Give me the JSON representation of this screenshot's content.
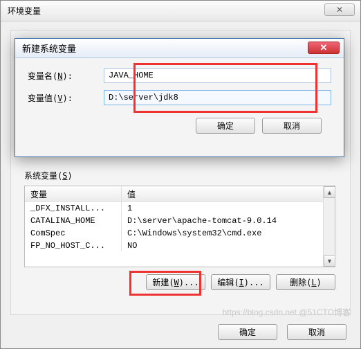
{
  "outer": {
    "title": "环境变量",
    "ok": "确定",
    "cancel": "取消"
  },
  "inner": {
    "title": "新建系统变量",
    "name_label_pre": "变量名(",
    "name_label_u": "N",
    "name_label_post": "):",
    "value_label_pre": "变量值(",
    "value_label_u": "V",
    "value_label_post": "):",
    "name_value": "JAVA_HOME",
    "value_value": "D:\\server\\jdk8",
    "ok": "确定",
    "cancel": "取消"
  },
  "sysvar": {
    "group_label_pre": "系统变量(",
    "group_label_u": "S",
    "group_label_post": ")",
    "col_var": "变量",
    "col_val": "值",
    "rows": [
      {
        "name": "_DFX_INSTALL...",
        "value": "1"
      },
      {
        "name": "CATALINA_HOME",
        "value": "D:\\server\\apache-tomcat-9.0.14"
      },
      {
        "name": "ComSpec",
        "value": "C:\\Windows\\system32\\cmd.exe"
      },
      {
        "name": "FP_NO_HOST_C...",
        "value": "NO"
      }
    ],
    "new_pre": "新建(",
    "new_u": "W",
    "new_post": ")...",
    "edit_pre": "编辑(",
    "edit_u": "I",
    "edit_post": ")...",
    "del_pre": "删除(",
    "del_u": "L",
    "del_post": ")"
  },
  "watermark": "https://blog.csdn.net   @51CTO博客"
}
